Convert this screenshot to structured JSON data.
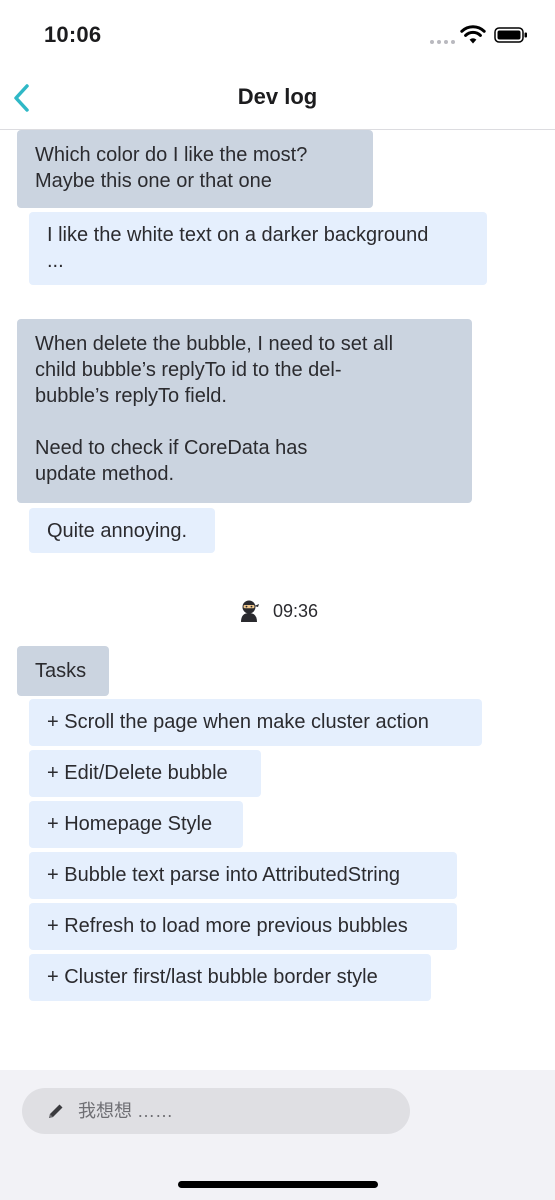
{
  "status_bar": {
    "time": "10:06"
  },
  "nav": {
    "title": "Dev log"
  },
  "messages": [
    {
      "text": "Which  color do I like the most?\nMaybe this one or that one"
    },
    {
      "text": "I like the white text on a darker background\n..."
    },
    {
      "text": "When delete the bubble, I need to set all\nchild bubble’s replyTo id to the del-\nbubble’s replyTo field.\n\nNeed to check if CoreData has\nupdate method."
    },
    {
      "text": "Quite annoying."
    }
  ],
  "timestamp": "09:36",
  "tasks": {
    "header": "Tasks",
    "items": [
      "+ Scroll the page when make cluster action",
      "+ Edit/Delete bubble",
      "+ Homepage Style",
      "+ Bubble text parse into AttributedString",
      "+ Refresh to load more previous bubbles",
      "+ Cluster first/last bubble border style"
    ]
  },
  "composer": {
    "placeholder": "我想想 ……"
  },
  "colors": {
    "accent": "#2fb8c6",
    "bubble_grey": "#cbd4e0",
    "bubble_blue": "#e5effd"
  }
}
